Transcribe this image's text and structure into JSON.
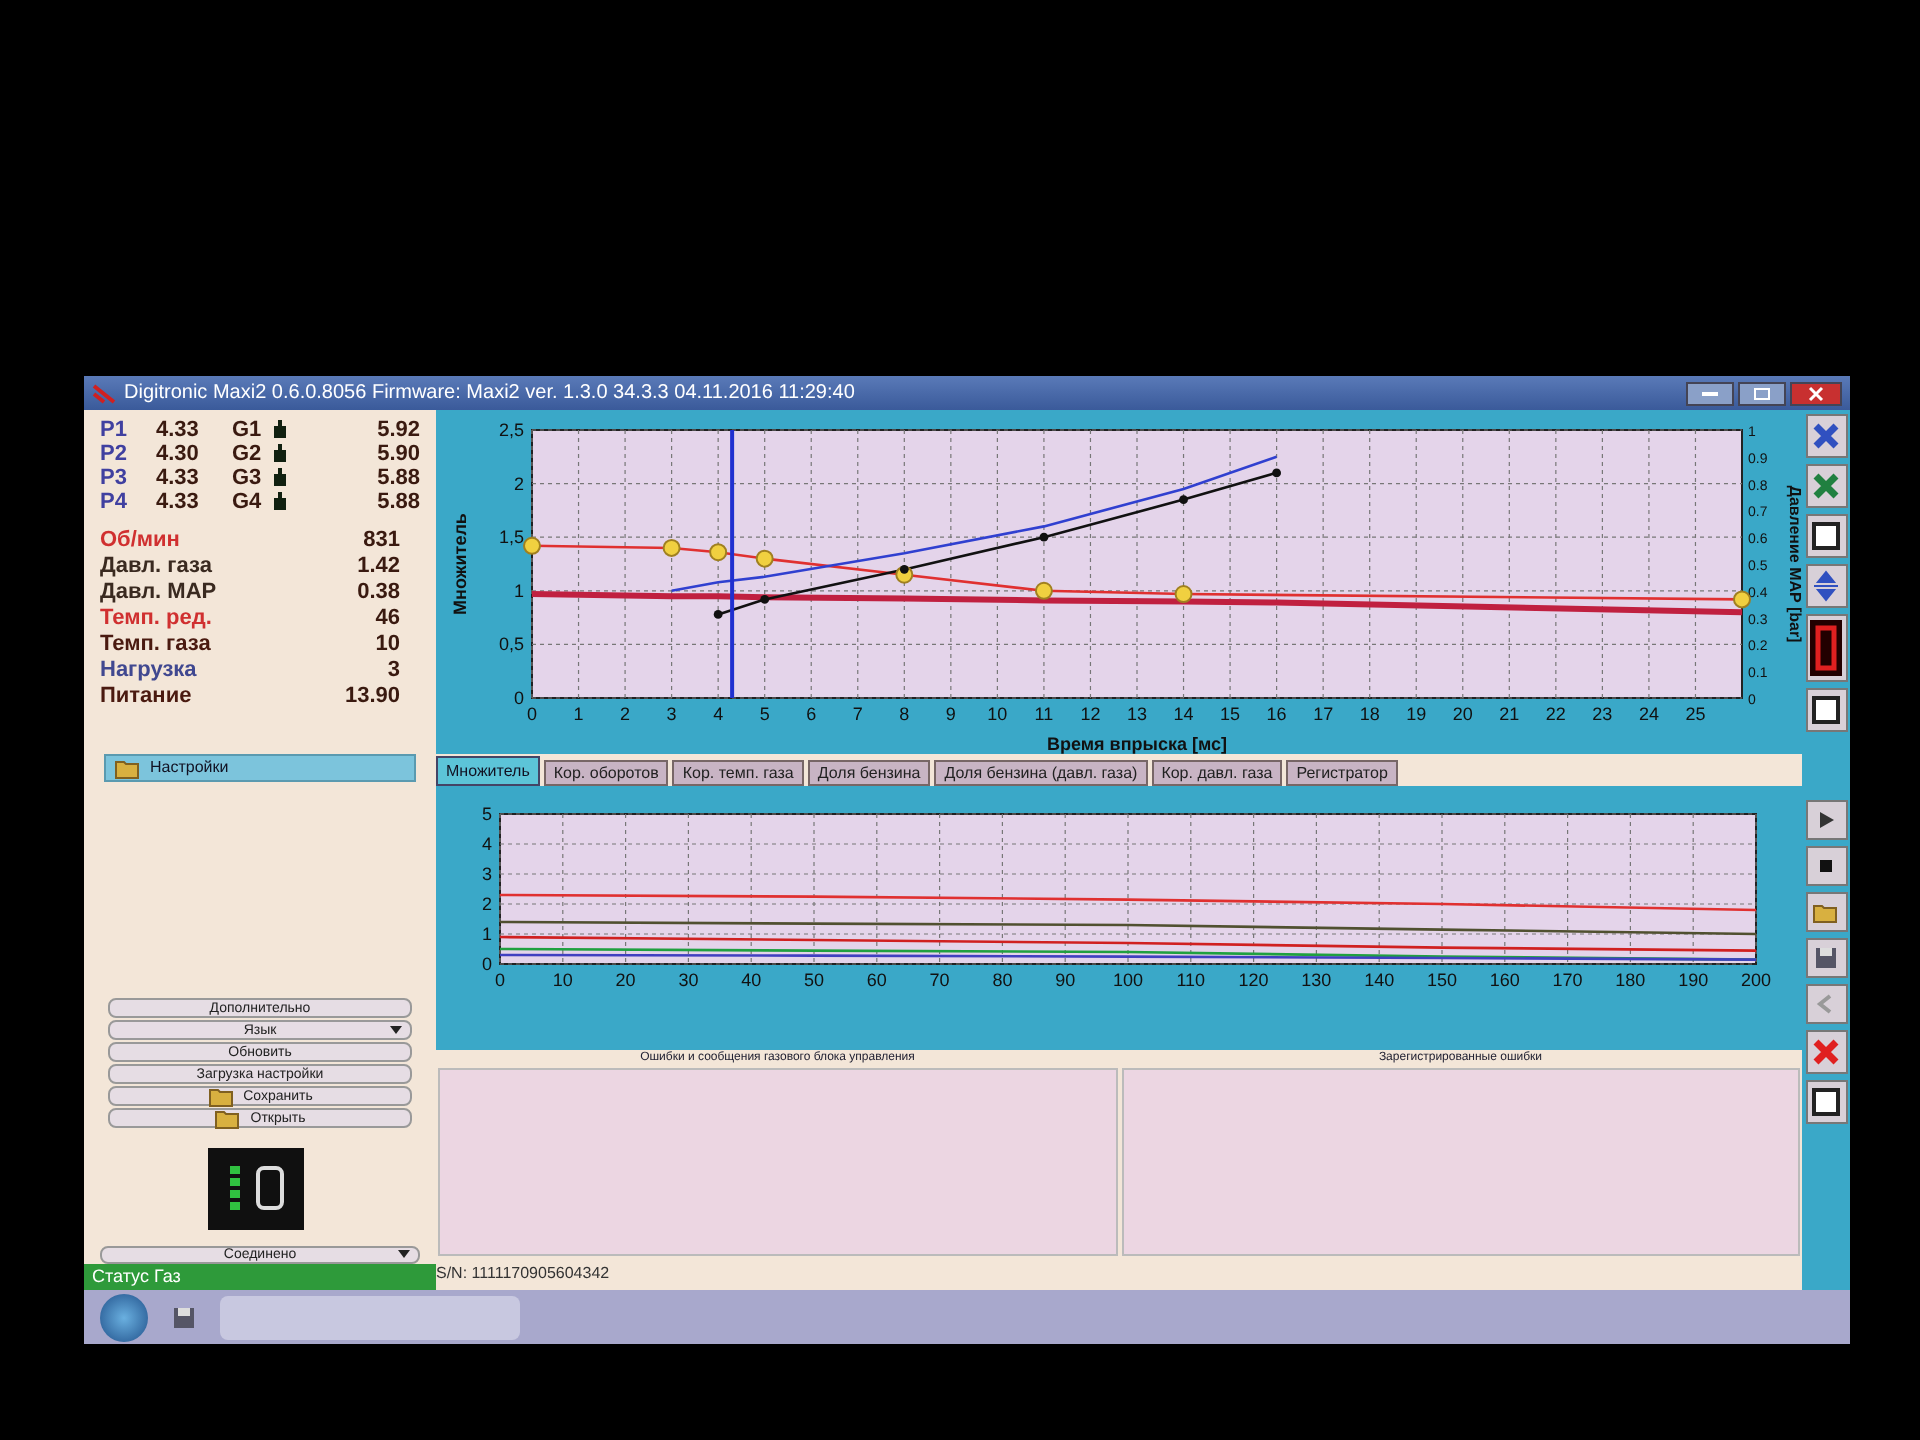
{
  "window": {
    "title": "Digitronic Maxi2 0.6.0.8056 Firmware: Maxi2 ver. 1.3.0  34.3.3  04.11.2016 11:29:40"
  },
  "injectors": [
    {
      "p": "P1",
      "p_value": "4.33",
      "g": "G1",
      "g_value": "5.92"
    },
    {
      "p": "P2",
      "p_value": "4.30",
      "g": "G2",
      "g_value": "5.90"
    },
    {
      "p": "P3",
      "p_value": "4.33",
      "g": "G3",
      "g_value": "5.88"
    },
    {
      "p": "P4",
      "p_value": "4.33",
      "g": "G4",
      "g_value": "5.88"
    }
  ],
  "readings": [
    {
      "label": "Об/мин",
      "value": "831",
      "color": "#d03030"
    },
    {
      "label": "Давл. газа",
      "value": "1.42",
      "color": "#3a2a20"
    },
    {
      "label": "Давл. MAP",
      "value": "0.38",
      "color": "#3a2a20"
    },
    {
      "label": "Темп. ред.",
      "value": "46",
      "color": "#d03030"
    },
    {
      "label": "Темп. газа",
      "value": "10",
      "color": "#4a1a10"
    },
    {
      "label": "Нагрузка",
      "value": "3",
      "color": "#404890"
    },
    {
      "label": "Питание",
      "value": "13.90",
      "color": "#4a1a10"
    }
  ],
  "settings_header": "Настройки",
  "left_buttons": [
    {
      "label": "Дополнительно",
      "kind": "button"
    },
    {
      "label": "Язык",
      "kind": "dropdown"
    },
    {
      "label": "Обновить",
      "kind": "button"
    },
    {
      "label": "Загрузка настройки",
      "kind": "button"
    },
    {
      "label": "Сохранить",
      "kind": "icon_button"
    },
    {
      "label": "Открыть",
      "kind": "icon_button"
    }
  ],
  "connection": {
    "value": "Соединено"
  },
  "status": "Статус Газ",
  "main_chart": {
    "chart_data": {
      "type": "line",
      "xlabel": "Время впрыска [мс]",
      "ylabel": "Множитель",
      "y2label": "Давление MAP [bar]",
      "x": [
        0,
        3,
        4,
        5,
        8,
        11,
        14,
        16,
        26
      ],
      "xlim": [
        0,
        26
      ],
      "ylim": [
        0,
        2.5
      ],
      "xticks": [
        0,
        1,
        2,
        3,
        4,
        5,
        6,
        7,
        8,
        9,
        10,
        11,
        12,
        13,
        14,
        15,
        16,
        17,
        18,
        19,
        20,
        21,
        22,
        23,
        24,
        25
      ],
      "yticks": [
        0,
        {
          "value": 0.5,
          "label": "0,5"
        },
        1,
        {
          "value": 1.5,
          "label": "1,5"
        },
        2,
        {
          "value": 2.5,
          "label": "2,5"
        }
      ],
      "y2ticks": [
        "0",
        "0.1",
        "0.2",
        "0.3",
        "0.4",
        "0.5",
        "0.6",
        "0.7",
        "0.8",
        "0.9",
        "1"
      ],
      "grid": true,
      "ref_lines": [
        {
          "axis": "x",
          "value": 4.3,
          "color": "#2030d0"
        }
      ],
      "series": [
        {
          "color": "#e03030",
          "marker": "circle",
          "values": [
            1.42,
            1.4,
            1.36,
            1.3,
            1.15,
            1.0,
            0.97,
            null,
            0.92
          ]
        },
        {
          "color": "#c02040",
          "values": [
            0.97,
            0.95,
            0.95,
            0.94,
            0.93,
            0.91,
            0.9,
            0.89,
            0.8
          ]
        },
        {
          "color": "#111111",
          "marker": "dot",
          "values": [
            null,
            null,
            0.78,
            0.92,
            1.2,
            1.5,
            1.85,
            2.1,
            null
          ]
        },
        {
          "color": "#3040d0",
          "values": [
            null,
            1.0,
            1.08,
            1.13,
            1.35,
            1.6,
            1.95,
            2.25,
            null
          ]
        }
      ]
    }
  },
  "tabs": [
    {
      "label": "Множитель",
      "selected": true
    },
    {
      "label": "Кор. оборотов",
      "selected": false
    },
    {
      "label": "Кор. темп. газа",
      "selected": false
    },
    {
      "label": "Доля бензина",
      "selected": false
    },
    {
      "label": "Доля бензина (давл. газа)",
      "selected": false
    },
    {
      "label": "Кор. давл. газа",
      "selected": false
    },
    {
      "label": "Регистратор",
      "selected": false
    }
  ],
  "lower_chart": {
    "chart_data": {
      "type": "line",
      "x": [
        0,
        50,
        100,
        150,
        200
      ],
      "xlim": [
        0,
        200
      ],
      "ylim": [
        0,
        5
      ],
      "xticks": [
        0,
        10,
        20,
        30,
        40,
        50,
        60,
        70,
        80,
        90,
        100,
        110,
        120,
        130,
        140,
        150,
        160,
        170,
        180,
        190,
        200
      ],
      "yticks": [
        0,
        1,
        2,
        3,
        4,
        5
      ],
      "grid": true,
      "series": [
        {
          "color": "#e03030",
          "values": [
            2.3,
            2.25,
            2.15,
            2.0,
            1.8
          ]
        },
        {
          "color": "#505030",
          "values": [
            1.4,
            1.35,
            1.3,
            1.15,
            1.0
          ]
        },
        {
          "color": "#d02020",
          "values": [
            0.9,
            0.8,
            0.7,
            0.55,
            0.45
          ]
        },
        {
          "color": "#20a040",
          "values": [
            0.5,
            0.45,
            0.4,
            0.25,
            0.15
          ]
        },
        {
          "color": "#4040c0",
          "values": [
            0.3,
            0.28,
            0.25,
            0.2,
            0.15
          ]
        }
      ]
    }
  },
  "errors_panel": {
    "title": "Ошибки и сообщения газового блока управления"
  },
  "registered_panel": {
    "title": "Зарегистрированные ошибки"
  },
  "serial": "S/N: 1111170905604342"
}
